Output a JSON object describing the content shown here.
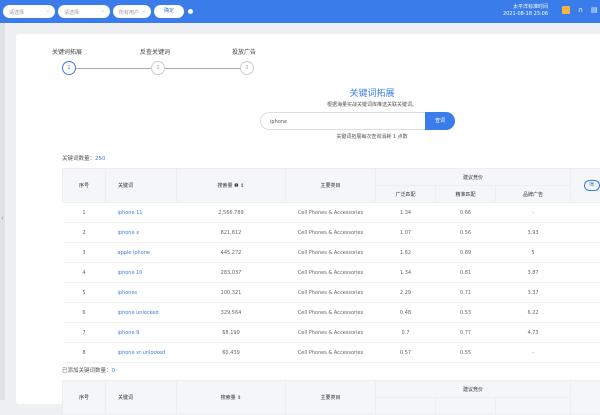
{
  "topbar": {
    "select1": "请选择",
    "select2": "请选择",
    "select3": "所有用户",
    "confirm": "确定",
    "timezone": "太平洋标准时间",
    "datetime": "2021-08-18 23:06"
  },
  "steps": [
    {
      "label": "关键词拓展",
      "num": "1"
    },
    {
      "label": "反查关键词",
      "num": "2"
    },
    {
      "label": "投放广告",
      "num": "3"
    }
  ],
  "main": {
    "title": "关键词拓展",
    "subtitle": "根据海量实战关键词库推送关联关键词。",
    "search_value": "iphone",
    "search_button": "查词",
    "note": "关键词拓展每次查询消耗 1 点数"
  },
  "keyword_count": {
    "label": "关键词数量：",
    "value": "250"
  },
  "added_count": {
    "label": "已添加关键词数量：",
    "value": "0"
  },
  "headers": {
    "index": "序号",
    "keyword": "关键词",
    "volume": "搜索量",
    "category": "主要类目",
    "bid": "建议竞价",
    "broad": "广泛匹配",
    "exact": "精准匹配",
    "brand": "品牌广告",
    "filter": "筛"
  },
  "rows": [
    {
      "i": "1",
      "kw": "iphone 11",
      "vol": "2,566,789",
      "cat": "Cell Phones & Accessories",
      "broad": "1.34",
      "exact": "0.66",
      "brand": "-"
    },
    {
      "i": "2",
      "kw": "iphone x",
      "vol": "821,812",
      "cat": "Cell Phones & Accessories",
      "broad": "1.07",
      "exact": "0.56",
      "brand": "3.93"
    },
    {
      "i": "3",
      "kw": "apple iphone",
      "vol": "445,272",
      "cat": "Cell Phones & Accessories",
      "broad": "1.62",
      "exact": "0.89",
      "brand": "5"
    },
    {
      "i": "4",
      "kw": "iphone 10",
      "vol": "283,037",
      "cat": "Cell Phones & Accessories",
      "broad": "1.34",
      "exact": "0.81",
      "brand": "3.87"
    },
    {
      "i": "5",
      "kw": "iphones",
      "vol": "100,321",
      "cat": "Cell Phones & Accessories",
      "broad": "2.29",
      "exact": "0.71",
      "brand": "3.37"
    },
    {
      "i": "6",
      "kw": "iphone unlocked",
      "vol": "329,564",
      "cat": "Cell Phones & Accessories",
      "broad": "0.48",
      "exact": "0.53",
      "brand": "6.22"
    },
    {
      "i": "7",
      "kw": "iphone 9",
      "vol": "68,199",
      "cat": "Cell Phones & Accessories",
      "broad": "0.7",
      "exact": "0.77",
      "brand": "4.73"
    },
    {
      "i": "8",
      "kw": "iphone xr unlocked",
      "vol": "60,439",
      "cat": "Cell Phones & Accessories",
      "broad": "0.57",
      "exact": "0.55",
      "brand": "-"
    }
  ]
}
